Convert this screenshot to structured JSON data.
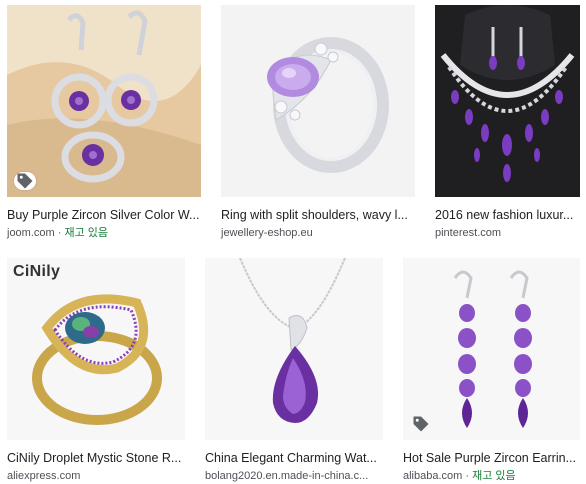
{
  "results": [
    {
      "title": "Buy Purple Zircon Silver Color W...",
      "source": "joom.com",
      "stock": "재고 있음",
      "thumb_icon": "tag-icon"
    },
    {
      "title": "Ring with split shoulders, wavy l...",
      "source": "jewellery-eshop.eu",
      "stock": "",
      "thumb_icon": ""
    },
    {
      "title": "2016 new fashion luxur...",
      "source": "pinterest.com",
      "stock": "",
      "thumb_icon": ""
    },
    {
      "title": "CiNily Droplet Mystic Stone R...",
      "source": "aliexpress.com",
      "stock": "",
      "thumb_icon": "",
      "brand": "CiNily"
    },
    {
      "title": "China Elegant Charming Wat...",
      "source": "bolang2020.en.made-in-china.c...",
      "stock": "",
      "thumb_icon": ""
    },
    {
      "title": "Hot Sale Purple Zircon Earrin...",
      "source": "alibaba.com",
      "stock": "재고 있음",
      "thumb_icon": "tag-icon"
    }
  ],
  "separator": " · ",
  "colors": {
    "amethyst": "#6a2fa0",
    "silver": "#d8d8de",
    "gold": "#c9a64a",
    "link_green": "#188038"
  }
}
